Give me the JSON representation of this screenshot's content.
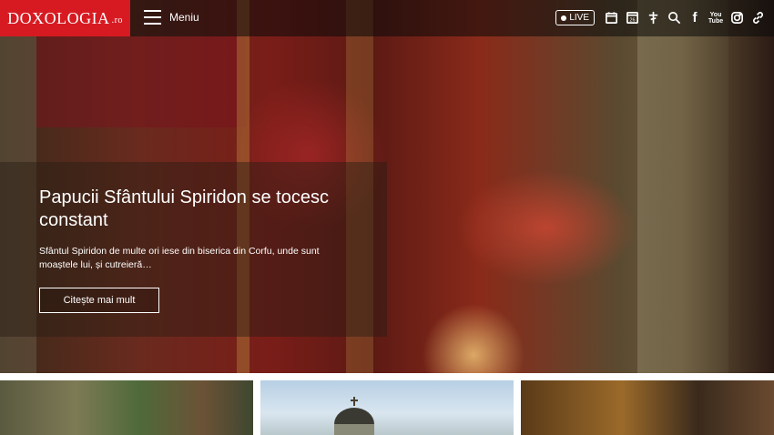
{
  "header": {
    "logo_main": "DOXOLOGIA",
    "logo_tld": ".ro",
    "menu_label": "Meniu",
    "live_label": "LIVE",
    "calendar_day": "26",
    "youtube_label": "You Tube",
    "facebook_label": "f"
  },
  "hero": {
    "title": "Papucii Sfântului Spiridon se tocesc constant",
    "excerpt": "Sfântul Spiridon de multe ori iese din biserica din Corfu, unde sunt moaștele lui, și cutreieră…",
    "cta_label": "Citește mai mult"
  },
  "colors": {
    "brand": "#d71a21",
    "topbar": "rgba(10,10,10,0.55)"
  },
  "icons": [
    "calendar-icon",
    "calendar-day-icon",
    "cross-icon",
    "search-icon",
    "facebook-icon",
    "youtube-icon",
    "instagram-icon",
    "link-icon"
  ]
}
